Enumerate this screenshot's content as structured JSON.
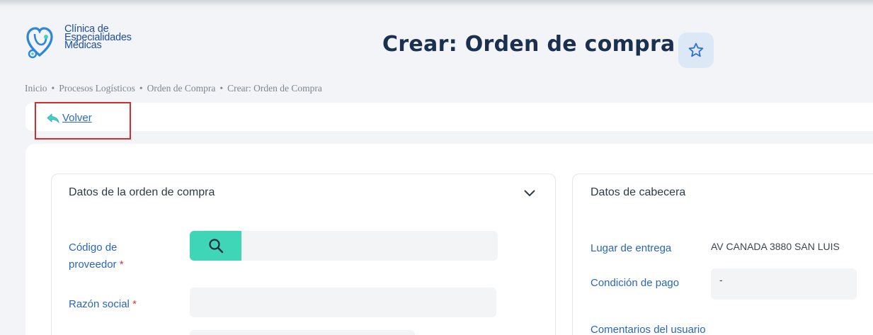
{
  "header": {
    "logo_lines": [
      "Clínica de",
      "Especialidades",
      "Médicas"
    ],
    "title": "Crear: Orden de compra"
  },
  "breadcrumb": [
    "Inicio",
    "Procesos Logísticos",
    "Orden de Compra",
    "Crear: Orden de Compra"
  ],
  "breadcrumb_separator": "•",
  "back": {
    "label": "Volver"
  },
  "colors": {
    "accent": "#3fd6b8",
    "link": "#2a6bbf",
    "highlight": "#d62c2c",
    "title": "#1b2f4e"
  },
  "order_card": {
    "title": "Datos de la orden de compra",
    "fields": {
      "supplier_code": {
        "label_line1": "Código de",
        "label_line2": "proveedor",
        "required_mark": "*",
        "value": ""
      },
      "business_name": {
        "label": "Razón social",
        "required_mark": "*",
        "value": ""
      }
    }
  },
  "header_card": {
    "title": "Datos de cabecera",
    "fields": {
      "delivery_place": {
        "label": "Lugar de entrega",
        "value": "AV CANADA  3880 SAN LUIS"
      },
      "payment_condition": {
        "label": "Condición de pago",
        "value": "-"
      },
      "user_comments": {
        "label": "Comentarios del usuario"
      }
    }
  }
}
